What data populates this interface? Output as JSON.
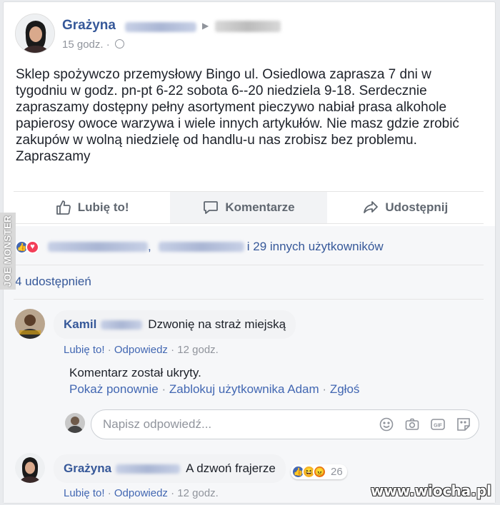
{
  "post": {
    "author_name": "Grażyna",
    "time": "15 godz. ·",
    "text": "Sklep spożywczo przemysłowy Bingo ul. Osiedlowa zaprasza 7 dni w\ntygodniu w godz. pn-pt 6-22 sobota 6--20 niedziela 9-18. Serdecznie\nzapraszamy dostępny pełny asortyment pieczywo nabiał prasa alkohole\npapierosy owoce warzywa i wiele innych artykułów. Nie masz gdzie zrobić\nzakupów w wolną niedzielę od handlu-u nas zrobisz bez problemu.\nZapraszamy"
  },
  "actions": {
    "like": "Lubię to!",
    "comment": "Komentarze",
    "share": "Udostępnij"
  },
  "reactions": {
    "separator": ",",
    "others_text": "i 29 innych użytkowników",
    "shares_text": "4 udostępnień"
  },
  "comments": [
    {
      "author": "Kamil",
      "text": "Dzwonię na straż miejską",
      "like": "Lubię to!",
      "reply": "Odpowiedz",
      "time": "12 godz."
    },
    {
      "author": "Grażyna",
      "text": "A dzwoń frajerze",
      "like": "Lubię to!",
      "reply": "Odpowiedz",
      "time": "12 godz.",
      "reaction_count": "26"
    }
  ],
  "hidden_comment": {
    "text": "Komentarz został ukryty.",
    "show_again": "Pokaż ponownie",
    "block": "Zablokuj użytkownika Adam",
    "report": "Zgłoś"
  },
  "reply_box": {
    "placeholder": "Napisz odpowiedź..."
  },
  "icons": [
    "thumbs-up-icon",
    "comment-icon",
    "share-icon",
    "emoji-icon",
    "camera-icon",
    "gif-icon",
    "sticker-icon",
    "globe-icon"
  ],
  "colors": {
    "link": "#365899",
    "muted": "#90949c",
    "like_blue": "#4267b2",
    "love_red": "#f33e58"
  },
  "watermarks": {
    "side": "JOE MONSTER",
    "corner": "www.wiocha.pl"
  }
}
